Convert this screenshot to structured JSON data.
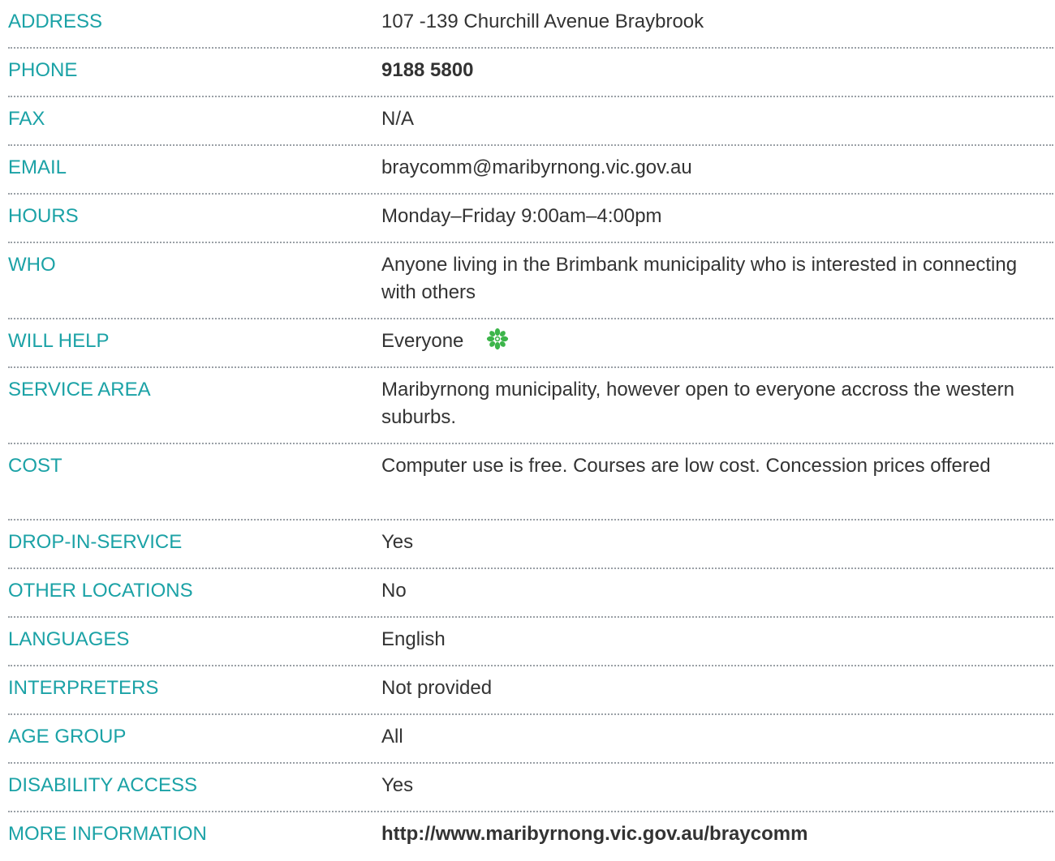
{
  "rows": [
    {
      "label": "ADDRESS",
      "value": "107 -139 Churchill Avenue Braybrook"
    },
    {
      "label": "PHONE",
      "value": "9188 5800"
    },
    {
      "label": "FAX",
      "value": "N/A"
    },
    {
      "label": "EMAIL",
      "value": "braycomm@maribyrnong.vic.gov.au"
    },
    {
      "label": "HOURS",
      "value": "Monday–Friday 9:00am–4:00pm"
    },
    {
      "label": "WHO",
      "value": "Anyone living in the Brimbank municipality who is interested in connecting with others"
    },
    {
      "label": "WILL HELP",
      "value": "Everyone",
      "icon": "green-flower-icon"
    },
    {
      "label": "SERVICE AREA",
      "value": "Maribyrnong municipality, however open to everyone accross the western suburbs."
    },
    {
      "label": "COST",
      "value": "Computer use is free. Courses are low cost. Concession prices offered"
    },
    {
      "label": "DROP-IN-SERVICE",
      "value": "Yes"
    },
    {
      "label": "OTHER LOCATIONS",
      "value": "No"
    },
    {
      "label": "LANGUAGES",
      "value": "English"
    },
    {
      "label": "INTERPRETERS",
      "value": "Not provided"
    },
    {
      "label": "AGE GROUP",
      "value": "All"
    },
    {
      "label": "DISABILITY ACCESS",
      "value": "Yes"
    },
    {
      "label": "MORE INFORMATION",
      "value": "http://www.maribyrnong.vic.gov.au/braycomm"
    }
  ],
  "colors": {
    "label": "#1ba2a6",
    "value": "#333333",
    "divider": "#9aa0a6",
    "icon": "#3cb54a"
  }
}
